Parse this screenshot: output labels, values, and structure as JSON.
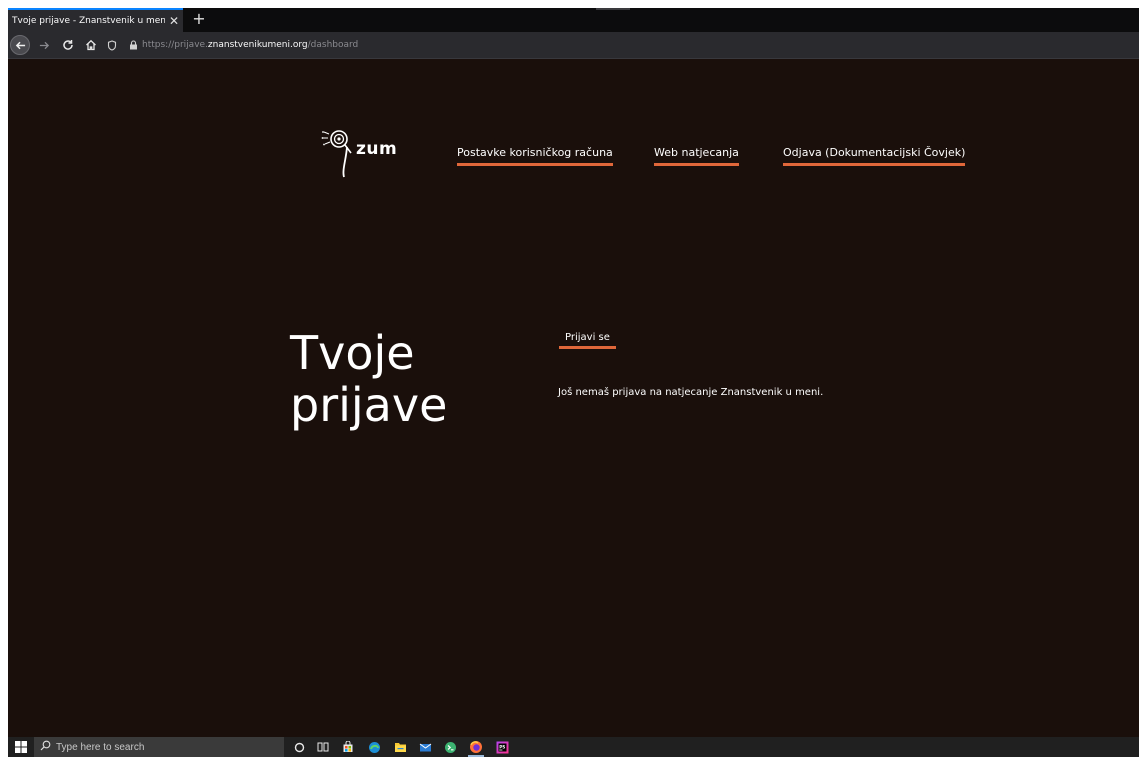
{
  "browser": {
    "tab_title": "Tvoje prijave - Znanstvenik u meni",
    "tab_close": "✕",
    "new_tab": "+",
    "url_prefix": "https://prijave.",
    "url_host": "znanstvenikumeni.org",
    "url_path": "/dashboard"
  },
  "site": {
    "logo_text": "zum",
    "nav": {
      "account_settings": "Postavke korisničkog računa",
      "web_competitions": "Web natjecanja",
      "logout": "Odjava (Dokumentacijski Čovjek)"
    },
    "accent_color": "#e0673a",
    "background_color": "#1a0f0b"
  },
  "main": {
    "title_line1": "Tvoje",
    "title_line2": "prijave",
    "apply_link": "Prijavi se",
    "empty_message": "Još nemaš prijava na natjecanje Znanstvenik u meni."
  },
  "taskbar": {
    "search_placeholder": "Type here to search",
    "icons": [
      "windows-start-icon",
      "search-icon",
      "cortana-icon",
      "task-view-icon",
      "store-icon",
      "edge-icon",
      "file-explorer-icon",
      "mail-icon",
      "terminal-icon",
      "firefox-icon",
      "phpstorm-icon"
    ],
    "phpstorm_label": "PS"
  }
}
